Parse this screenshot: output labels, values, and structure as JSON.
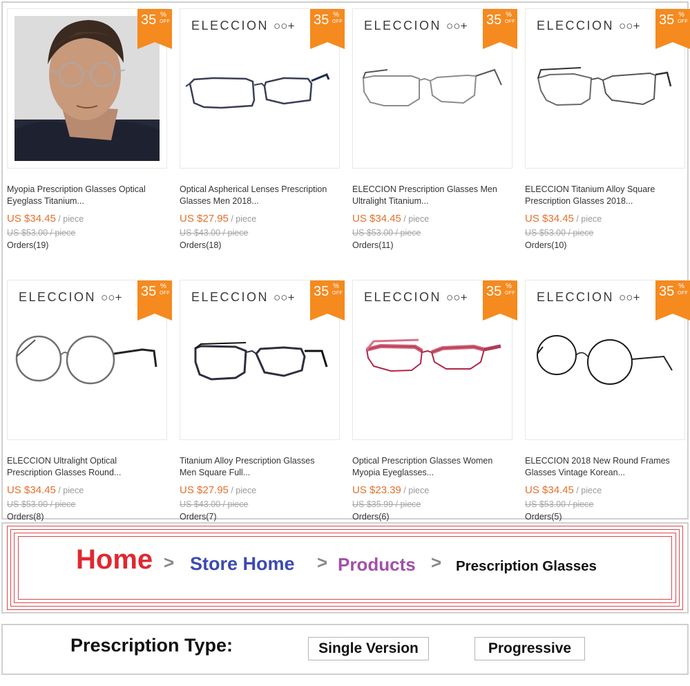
{
  "products": [
    {
      "badge_value": "35",
      "badge_percent": "%",
      "badge_off": "OFF",
      "brand_logo": "",
      "image": "man-wearing-glasses",
      "title_line1": "Myopia Prescription Glasses Optical",
      "title_line2": "Eyeglass Titanium...",
      "price": "US $34.45",
      "unit": " / piece",
      "old_price": "US $53.00 / piece",
      "orders": "Orders(19)"
    },
    {
      "badge_value": "35",
      "badge_percent": "%",
      "badge_off": "OFF",
      "brand_logo": "ELECCION",
      "image": "rectangle-full-rim-navy",
      "title_line1": "Optical Aspherical Lenses Prescription",
      "title_line2": "Glasses Men 2018...",
      "price": "US $27.95",
      "unit": " / piece",
      "old_price": "US $43.00 / piece",
      "orders": "Orders(18)"
    },
    {
      "badge_value": "35",
      "badge_percent": "%",
      "badge_off": "OFF",
      "brand_logo": "ELECCION",
      "image": "semi-rimless-silver",
      "title_line1": "ELECCION Prescription Glasses Men",
      "title_line2": "Ultralight Titanium...",
      "price": "US $34.45",
      "unit": " / piece",
      "old_price": "US $53.00 / piece",
      "orders": "Orders(11)"
    },
    {
      "badge_value": "35",
      "badge_percent": "%",
      "badge_off": "OFF",
      "brand_logo": "ELECCION",
      "image": "semi-rimless-square-black",
      "title_line1": "ELECCION Titanium Alloy Square",
      "title_line2": "Prescription Glasses 2018...",
      "price": "US $34.45",
      "unit": " / piece",
      "old_price": "US $53.00 / piece",
      "orders": "Orders(10)"
    },
    {
      "badge_value": "35",
      "badge_percent": "%",
      "badge_off": "OFF",
      "brand_logo": "ELECCION",
      "image": "round-full-rim-gunmetal",
      "title_line1": "ELECCION Ultralight Optical",
      "title_line2": "Prescription Glasses Round...",
      "price": "US $34.45",
      "unit": " / piece",
      "old_price": "US $53.00 / piece",
      "orders": "Orders(8)"
    },
    {
      "badge_value": "35",
      "badge_percent": "%",
      "badge_off": "OFF",
      "brand_logo": "ELECCION",
      "image": "square-full-rim-black",
      "title_line1": "Titanium Alloy Prescription Glasses",
      "title_line2": "Men Square Full...",
      "price": "US $27.95",
      "unit": " / piece",
      "old_price": "US $43.00 / piece",
      "orders": "Orders(7)"
    },
    {
      "badge_value": "35",
      "badge_percent": "%",
      "badge_off": "OFF",
      "brand_logo": "ELECCION",
      "image": "semi-rimless-pink-floral",
      "title_line1": "Optical Prescription Glasses Women",
      "title_line2": "Myopia Eyeglasses...",
      "price": "US $23.39",
      "unit": " / piece",
      "old_price": "US $35.99 / piece",
      "orders": "Orders(6)"
    },
    {
      "badge_value": "35",
      "badge_percent": "%",
      "badge_off": "OFF",
      "brand_logo": "ELECCION",
      "image": "round-thin-black",
      "title_line1": "ELECCION 2018 New Round Frames",
      "title_line2": "Glasses Vintage Korean...",
      "price": "US $34.45",
      "unit": " / piece",
      "old_price": "US $53.00 / piece",
      "orders": "Orders(5)"
    }
  ],
  "breadcrumb": {
    "home": "Home",
    "store_home": "Store Home",
    "products": "Products",
    "current": "Prescription Glasses",
    "separator": ">"
  },
  "prescription": {
    "label": "Prescription Type:",
    "options": [
      "Single Version",
      "Progressive"
    ]
  },
  "colors": {
    "price": "#e3702a",
    "badge": "#f58a1f",
    "home": "#e02830",
    "store_home": "#3b4bb0",
    "products": "#a24fa8",
    "breadcrumb_frame": "#d8484e"
  }
}
